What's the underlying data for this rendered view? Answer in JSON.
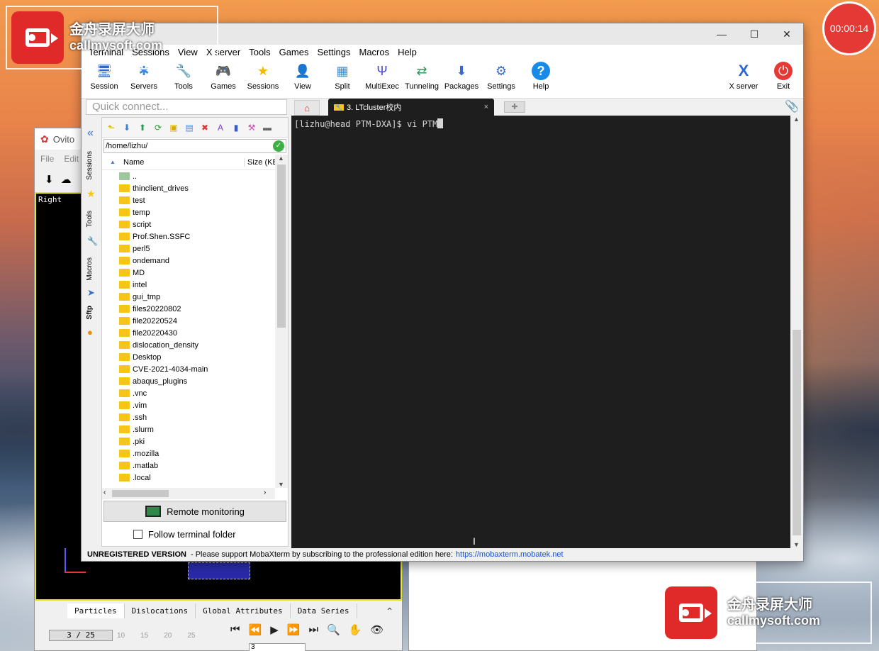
{
  "recorder": {
    "brand": "金舟录屏大师",
    "url": "callmysoft.com",
    "timer": "00:00:14"
  },
  "ovito": {
    "title": "Ovito",
    "menu": [
      "File",
      "Edit"
    ],
    "viewport_label": "Right",
    "tabs": [
      "Particles",
      "Dislocations",
      "Global Attributes",
      "Data Series"
    ],
    "frame": "3 / 25",
    "ticks": [
      "10",
      "15",
      "20",
      "25"
    ],
    "frame_input": "3"
  },
  "moba": {
    "menu": [
      "Terminal",
      "Sessions",
      "View",
      "X server",
      "Tools",
      "Games",
      "Settings",
      "Macros",
      "Help"
    ],
    "toolbar": [
      {
        "label": "Session",
        "icon": "session-icon",
        "glyph": "🖥"
      },
      {
        "label": "Servers",
        "icon": "servers-icon",
        "glyph": "✱"
      },
      {
        "label": "Tools",
        "icon": "tools-icon",
        "glyph": "🔧"
      },
      {
        "label": "Games",
        "icon": "games-icon",
        "glyph": "🎮"
      },
      {
        "label": "Sessions",
        "icon": "star-icon",
        "glyph": "★"
      },
      {
        "label": "View",
        "icon": "view-icon",
        "glyph": "👤"
      },
      {
        "label": "Split",
        "icon": "split-icon",
        "glyph": "▦"
      },
      {
        "label": "MultiExec",
        "icon": "multiexec-icon",
        "glyph": "Ψ"
      },
      {
        "label": "Tunneling",
        "icon": "tunneling-icon",
        "glyph": "⇄"
      },
      {
        "label": "Packages",
        "icon": "packages-icon",
        "glyph": "⬇"
      },
      {
        "label": "Settings",
        "icon": "settings-icon",
        "glyph": "⚙"
      },
      {
        "label": "Help",
        "icon": "help-icon",
        "glyph": "?"
      }
    ],
    "toolbar_right": [
      {
        "label": "X server",
        "icon": "xserver-icon",
        "glyph": "X"
      },
      {
        "label": "Exit",
        "icon": "power-icon",
        "glyph": "⏻"
      }
    ],
    "quick_connect_placeholder": "Quick connect...",
    "tab_title": "3. LTcluster校内",
    "side_tabs": [
      "Sessions",
      "Tools",
      "Macros",
      "Sftp"
    ],
    "path": "/home/lizhu/",
    "columns": {
      "name": "Name",
      "size": "Size (KE"
    },
    "files": [
      "..",
      "thinclient_drives",
      "test",
      "temp",
      "script",
      "Prof.Shen.SSFC",
      "perl5",
      "ondemand",
      "MD",
      "intel",
      "gui_tmp",
      "files20220802",
      "file20220524",
      "file20220430",
      "dislocation_density",
      "Desktop",
      "CVE-2021-4034-main",
      "abaqus_plugins",
      ".vnc",
      ".vim",
      ".ssh",
      ".slurm",
      ".pki",
      ".mozilla",
      ".matlab",
      ".local"
    ],
    "remote_monitoring": "Remote monitoring",
    "follow_folder": "Follow terminal folder",
    "terminal_prompt": "[lizhu@head PTM-DXA]$ vi PTM",
    "status_bold": "UNREGISTERED VERSION",
    "status_text": " -  Please support MobaXterm by subscribing to the professional edition here:",
    "status_link": "https://mobaxterm.mobatek.net"
  },
  "colors": {
    "terminal_bg": "#1e1e1e",
    "folder": "#f5c518",
    "accent_red": "#e53935"
  }
}
